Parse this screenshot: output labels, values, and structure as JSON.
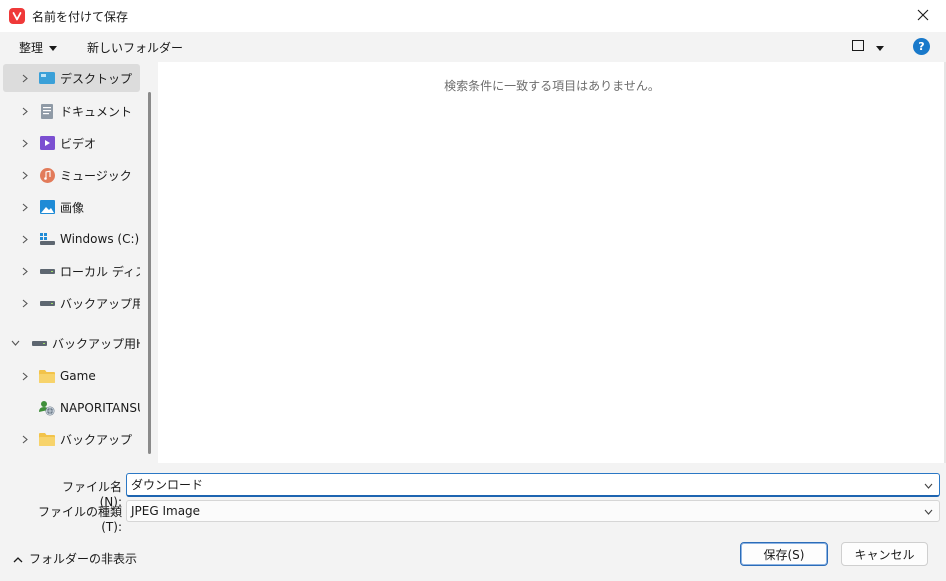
{
  "window": {
    "title": "名前を付けて保存",
    "app_icon": "vivaldi-icon",
    "close_icon": "close-icon"
  },
  "toolbar": {
    "organize_label": "整理",
    "new_folder_label": "新しいフォルダー",
    "view_icon": "view-mode-icon",
    "help_label": "?"
  },
  "nav": {
    "items": [
      {
        "label": "デスクトップ",
        "icon": "desktop-icon",
        "expanded": false,
        "selected": true
      },
      {
        "label": "ドキュメント",
        "icon": "documents-icon",
        "expanded": false,
        "selected": false
      },
      {
        "label": "ビデオ",
        "icon": "videos-icon",
        "expanded": false,
        "selected": false
      },
      {
        "label": "ミュージック",
        "icon": "music-icon",
        "expanded": false,
        "selected": false
      },
      {
        "label": "画像",
        "icon": "pictures-icon",
        "expanded": false,
        "selected": false
      },
      {
        "label": "Windows (C:)",
        "icon": "windows-drive-icon",
        "expanded": false,
        "selected": false
      },
      {
        "label": "ローカル ディスク (",
        "icon": "drive-icon",
        "expanded": false,
        "selected": false
      },
      {
        "label": "バックアップ用HD",
        "icon": "drive-icon",
        "expanded": false,
        "selected": false
      },
      {
        "label": "バックアップ用HDD",
        "icon": "drive-icon",
        "expanded": true,
        "selected": false
      },
      {
        "label": "Game",
        "icon": "folder-icon",
        "expanded": false,
        "selected": false
      },
      {
        "label": "NAPORITANSU",
        "icon": "network-user-icon",
        "expanded": false,
        "selected": false
      },
      {
        "label": "バックアップ",
        "icon": "folder-icon",
        "expanded": false,
        "selected": false
      }
    ]
  },
  "content": {
    "empty_message": "検索条件に一致する項目はありません。"
  },
  "form": {
    "filename_label": "ファイル名(N):",
    "filename_value": "ダウンロード",
    "filetype_label": "ファイルの種類(T):",
    "filetype_value": "JPEG Image"
  },
  "footer": {
    "hide_folders_label": "フォルダーの非表示",
    "save_label": "保存(S)",
    "cancel_label": "キャンセル"
  },
  "colors": {
    "accent": "#1979ca",
    "app_red": "#ef3939",
    "folder_yellow": "#f2c34a"
  }
}
